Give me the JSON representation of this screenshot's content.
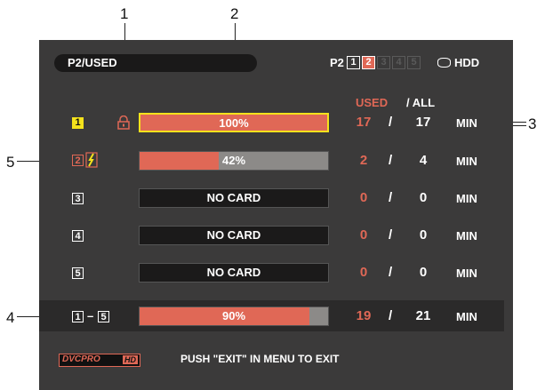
{
  "callouts": [
    "1",
    "2",
    "3",
    "4",
    "5"
  ],
  "topbar": {
    "label": "P2/USED",
    "media": "P2",
    "slots": [
      "1",
      "2",
      "3",
      "4",
      "5"
    ],
    "hdd_label": "HDD"
  },
  "header": {
    "used": "USED",
    "all": "/ ALL"
  },
  "rows": [
    {
      "slot": "1",
      "bar_text": "100%",
      "fill": 1.0,
      "used": "17",
      "slash": "/",
      "all": "17",
      "unit": "MIN"
    },
    {
      "slot": "2",
      "bar_text": "42%",
      "fill": 0.42,
      "used": "2",
      "slash": "/",
      "all": "4",
      "unit": "MIN"
    },
    {
      "slot": "3",
      "bar_text": "NO CARD",
      "fill": 0,
      "used": "0",
      "slash": "/",
      "all": "0",
      "unit": "MIN"
    },
    {
      "slot": "4",
      "bar_text": "NO CARD",
      "fill": 0,
      "used": "0",
      "slash": "/",
      "all": "0",
      "unit": "MIN"
    },
    {
      "slot": "5",
      "bar_text": "NO CARD",
      "fill": 0,
      "used": "0",
      "slash": "/",
      "all": "0",
      "unit": "MIN"
    }
  ],
  "total": {
    "range_start": "1",
    "range_sep": "–",
    "range_end": "5",
    "bar_text": "90%",
    "fill": 0.9,
    "used": "19",
    "slash": "/",
    "all": "21",
    "unit": "MIN"
  },
  "footer": {
    "logo_main": "DVCPRO",
    "logo_hd": "HD",
    "message": "PUSH \"EXIT\" IN MENU TO EXIT"
  },
  "colors": {
    "accent_red": "#e06856",
    "highlight_yellow": "#f4e21c",
    "screen_bg": "#3b3a3a"
  }
}
